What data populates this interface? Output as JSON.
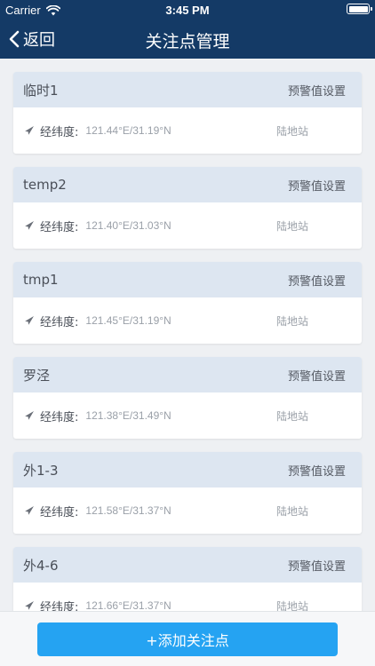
{
  "status_bar": {
    "carrier": "Carrier",
    "time": "3:45 PM",
    "wifi_icon": "wifi-icon",
    "battery_icon": "battery-icon"
  },
  "navbar": {
    "back_label": "返回",
    "title": "关注点管理",
    "background_color": "#143a66"
  },
  "cards": [
    {
      "name": "临时1",
      "settings_label": "预警值设置",
      "coord_label": "经纬度:",
      "coord_value": "121.44°E/31.19°N",
      "station_type": "陆地站"
    },
    {
      "name": "temp2",
      "settings_label": "预警值设置",
      "coord_label": "经纬度:",
      "coord_value": "121.40°E/31.03°N",
      "station_type": "陆地站"
    },
    {
      "name": "tmp1",
      "settings_label": "预警值设置",
      "coord_label": "经纬度:",
      "coord_value": "121.45°E/31.19°N",
      "station_type": "陆地站"
    },
    {
      "name": "罗泾",
      "settings_label": "预警值设置",
      "coord_label": "经纬度:",
      "coord_value": "121.38°E/31.49°N",
      "station_type": "陆地站"
    },
    {
      "name": "外1-3",
      "settings_label": "预警值设置",
      "coord_label": "经纬度:",
      "coord_value": "121.58°E/31.37°N",
      "station_type": "陆地站"
    },
    {
      "name": "外4-6",
      "settings_label": "预警值设置",
      "coord_label": "经纬度:",
      "coord_value": "121.66°E/31.37°N",
      "station_type": "陆地站"
    }
  ],
  "footer": {
    "add_button_label": "+添加关注点",
    "button_color": "#25a3f2"
  }
}
